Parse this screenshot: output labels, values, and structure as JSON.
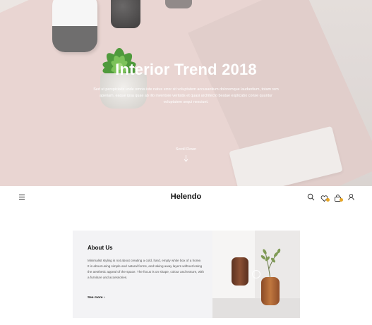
{
  "hero": {
    "title": "Interior Trend 2018",
    "text": "Sed ut perspiciatis unde omnis iste natus error sit voluptatem accusantium doloremque laudantium, totam rem aperiam, eaque ipsa quae ab illo inventore veritatis et quasi architecto beatae explicabo conse quuntur voluptatem sequi nesciunt.",
    "scroll_label": "Scroll Down"
  },
  "header": {
    "logo": "Helendo",
    "icons": [
      "menu-icon",
      "search-icon",
      "heart-icon",
      "cart-icon",
      "user-icon"
    ],
    "badge_color": "#e7a524"
  },
  "about": {
    "title": "About Us",
    "text": "Minimalist styling is not about creating a cold, hard, empty white box of a home. It is about using simple and natural forms, and taking away layers without losing the aesthetic appeal of the space. The focus is on shape, colour and texture, with a  furniture and accessories.",
    "see_more": "See more",
    "see_more_arrow": "›"
  }
}
